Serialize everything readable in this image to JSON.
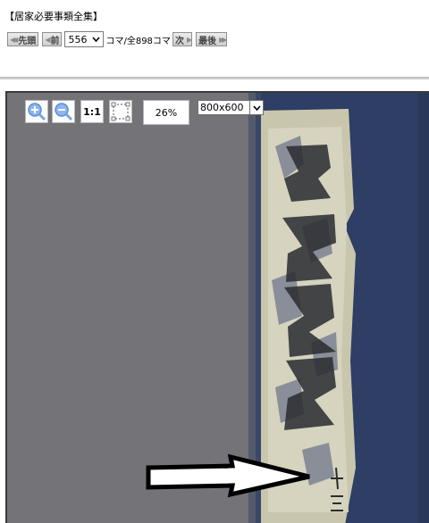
{
  "header": {
    "title": "【居家必要事類全集】"
  },
  "nav": {
    "first_label": "先頭",
    "prev_label": "前",
    "frame_select": "556",
    "count_text": "コマ/全898コマ",
    "next_label": "次",
    "last_label": "最後"
  },
  "viewer": {
    "zoom_level": "26%",
    "one_to_one_label": "1:1",
    "size_select": "800x600"
  },
  "colors": {
    "viewer_bg": "#737378",
    "cover_blue": "#2e3e64",
    "title_strip": "#d6d3bf",
    "accent_icon": "#5b8fd8"
  },
  "icons": [
    "zoom-in-icon",
    "zoom-out-icon",
    "fit-page-icon",
    "chevron-down-icon",
    "double-left-triangle-icon",
    "left-triangle-icon",
    "right-triangle-icon",
    "double-right-triangle-icon"
  ]
}
